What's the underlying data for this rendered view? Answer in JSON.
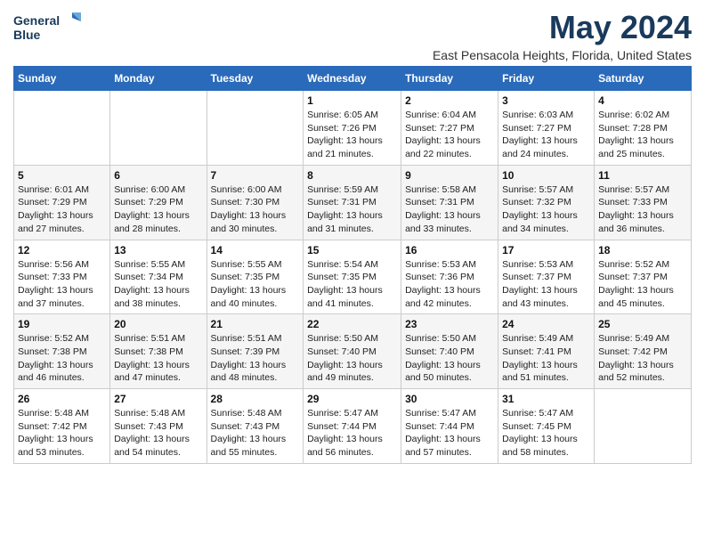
{
  "header": {
    "logo_line1": "General",
    "logo_line2": "Blue",
    "title": "May 2024",
    "subtitle": "East Pensacola Heights, Florida, United States"
  },
  "weekdays": [
    "Sunday",
    "Monday",
    "Tuesday",
    "Wednesday",
    "Thursday",
    "Friday",
    "Saturday"
  ],
  "weeks": [
    [
      {
        "day": "",
        "info": ""
      },
      {
        "day": "",
        "info": ""
      },
      {
        "day": "",
        "info": ""
      },
      {
        "day": "1",
        "info": "Sunrise: 6:05 AM\nSunset: 7:26 PM\nDaylight: 13 hours\nand 21 minutes."
      },
      {
        "day": "2",
        "info": "Sunrise: 6:04 AM\nSunset: 7:27 PM\nDaylight: 13 hours\nand 22 minutes."
      },
      {
        "day": "3",
        "info": "Sunrise: 6:03 AM\nSunset: 7:27 PM\nDaylight: 13 hours\nand 24 minutes."
      },
      {
        "day": "4",
        "info": "Sunrise: 6:02 AM\nSunset: 7:28 PM\nDaylight: 13 hours\nand 25 minutes."
      }
    ],
    [
      {
        "day": "5",
        "info": "Sunrise: 6:01 AM\nSunset: 7:29 PM\nDaylight: 13 hours\nand 27 minutes."
      },
      {
        "day": "6",
        "info": "Sunrise: 6:00 AM\nSunset: 7:29 PM\nDaylight: 13 hours\nand 28 minutes."
      },
      {
        "day": "7",
        "info": "Sunrise: 6:00 AM\nSunset: 7:30 PM\nDaylight: 13 hours\nand 30 minutes."
      },
      {
        "day": "8",
        "info": "Sunrise: 5:59 AM\nSunset: 7:31 PM\nDaylight: 13 hours\nand 31 minutes."
      },
      {
        "day": "9",
        "info": "Sunrise: 5:58 AM\nSunset: 7:31 PM\nDaylight: 13 hours\nand 33 minutes."
      },
      {
        "day": "10",
        "info": "Sunrise: 5:57 AM\nSunset: 7:32 PM\nDaylight: 13 hours\nand 34 minutes."
      },
      {
        "day": "11",
        "info": "Sunrise: 5:57 AM\nSunset: 7:33 PM\nDaylight: 13 hours\nand 36 minutes."
      }
    ],
    [
      {
        "day": "12",
        "info": "Sunrise: 5:56 AM\nSunset: 7:33 PM\nDaylight: 13 hours\nand 37 minutes."
      },
      {
        "day": "13",
        "info": "Sunrise: 5:55 AM\nSunset: 7:34 PM\nDaylight: 13 hours\nand 38 minutes."
      },
      {
        "day": "14",
        "info": "Sunrise: 5:55 AM\nSunset: 7:35 PM\nDaylight: 13 hours\nand 40 minutes."
      },
      {
        "day": "15",
        "info": "Sunrise: 5:54 AM\nSunset: 7:35 PM\nDaylight: 13 hours\nand 41 minutes."
      },
      {
        "day": "16",
        "info": "Sunrise: 5:53 AM\nSunset: 7:36 PM\nDaylight: 13 hours\nand 42 minutes."
      },
      {
        "day": "17",
        "info": "Sunrise: 5:53 AM\nSunset: 7:37 PM\nDaylight: 13 hours\nand 43 minutes."
      },
      {
        "day": "18",
        "info": "Sunrise: 5:52 AM\nSunset: 7:37 PM\nDaylight: 13 hours\nand 45 minutes."
      }
    ],
    [
      {
        "day": "19",
        "info": "Sunrise: 5:52 AM\nSunset: 7:38 PM\nDaylight: 13 hours\nand 46 minutes."
      },
      {
        "day": "20",
        "info": "Sunrise: 5:51 AM\nSunset: 7:38 PM\nDaylight: 13 hours\nand 47 minutes."
      },
      {
        "day": "21",
        "info": "Sunrise: 5:51 AM\nSunset: 7:39 PM\nDaylight: 13 hours\nand 48 minutes."
      },
      {
        "day": "22",
        "info": "Sunrise: 5:50 AM\nSunset: 7:40 PM\nDaylight: 13 hours\nand 49 minutes."
      },
      {
        "day": "23",
        "info": "Sunrise: 5:50 AM\nSunset: 7:40 PM\nDaylight: 13 hours\nand 50 minutes."
      },
      {
        "day": "24",
        "info": "Sunrise: 5:49 AM\nSunset: 7:41 PM\nDaylight: 13 hours\nand 51 minutes."
      },
      {
        "day": "25",
        "info": "Sunrise: 5:49 AM\nSunset: 7:42 PM\nDaylight: 13 hours\nand 52 minutes."
      }
    ],
    [
      {
        "day": "26",
        "info": "Sunrise: 5:48 AM\nSunset: 7:42 PM\nDaylight: 13 hours\nand 53 minutes."
      },
      {
        "day": "27",
        "info": "Sunrise: 5:48 AM\nSunset: 7:43 PM\nDaylight: 13 hours\nand 54 minutes."
      },
      {
        "day": "28",
        "info": "Sunrise: 5:48 AM\nSunset: 7:43 PM\nDaylight: 13 hours\nand 55 minutes."
      },
      {
        "day": "29",
        "info": "Sunrise: 5:47 AM\nSunset: 7:44 PM\nDaylight: 13 hours\nand 56 minutes."
      },
      {
        "day": "30",
        "info": "Sunrise: 5:47 AM\nSunset: 7:44 PM\nDaylight: 13 hours\nand 57 minutes."
      },
      {
        "day": "31",
        "info": "Sunrise: 5:47 AM\nSunset: 7:45 PM\nDaylight: 13 hours\nand 58 minutes."
      },
      {
        "day": "",
        "info": ""
      }
    ]
  ]
}
